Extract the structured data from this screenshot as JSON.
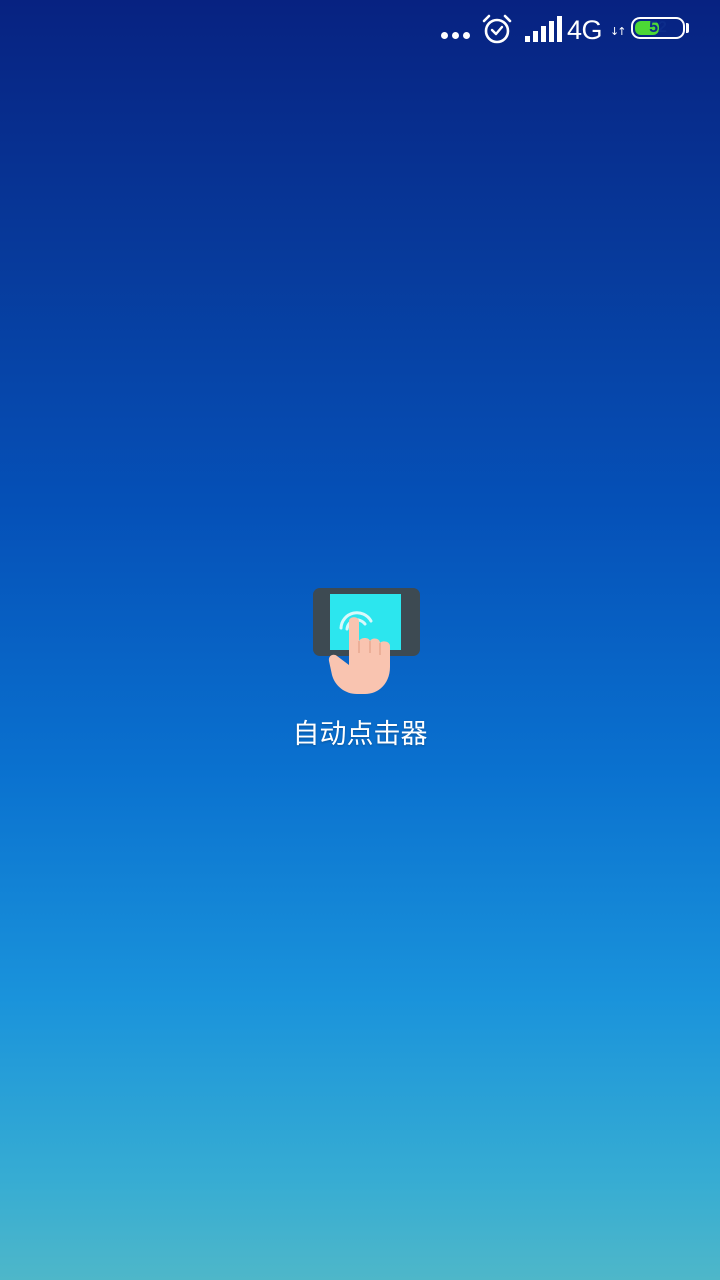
{
  "status_bar": {
    "network_type": "4G",
    "network_arrows": "↓↑",
    "battery_level": "52",
    "battery_percent": 52,
    "icons": [
      "more-dots-icon",
      "alarm-clock-icon",
      "signal-bars-icon",
      "battery-icon"
    ],
    "battery_fill_color": "#4cd836"
  },
  "app": {
    "label": "自动点击器",
    "icon": "auto-clicker-tap-icon"
  },
  "colors": {
    "background_top": "#072281",
    "background_bottom": "#4eb7c9",
    "icon_screen": "#2ce6ee",
    "icon_device": "#3d4a52",
    "icon_hand": "#f9c4b0"
  }
}
